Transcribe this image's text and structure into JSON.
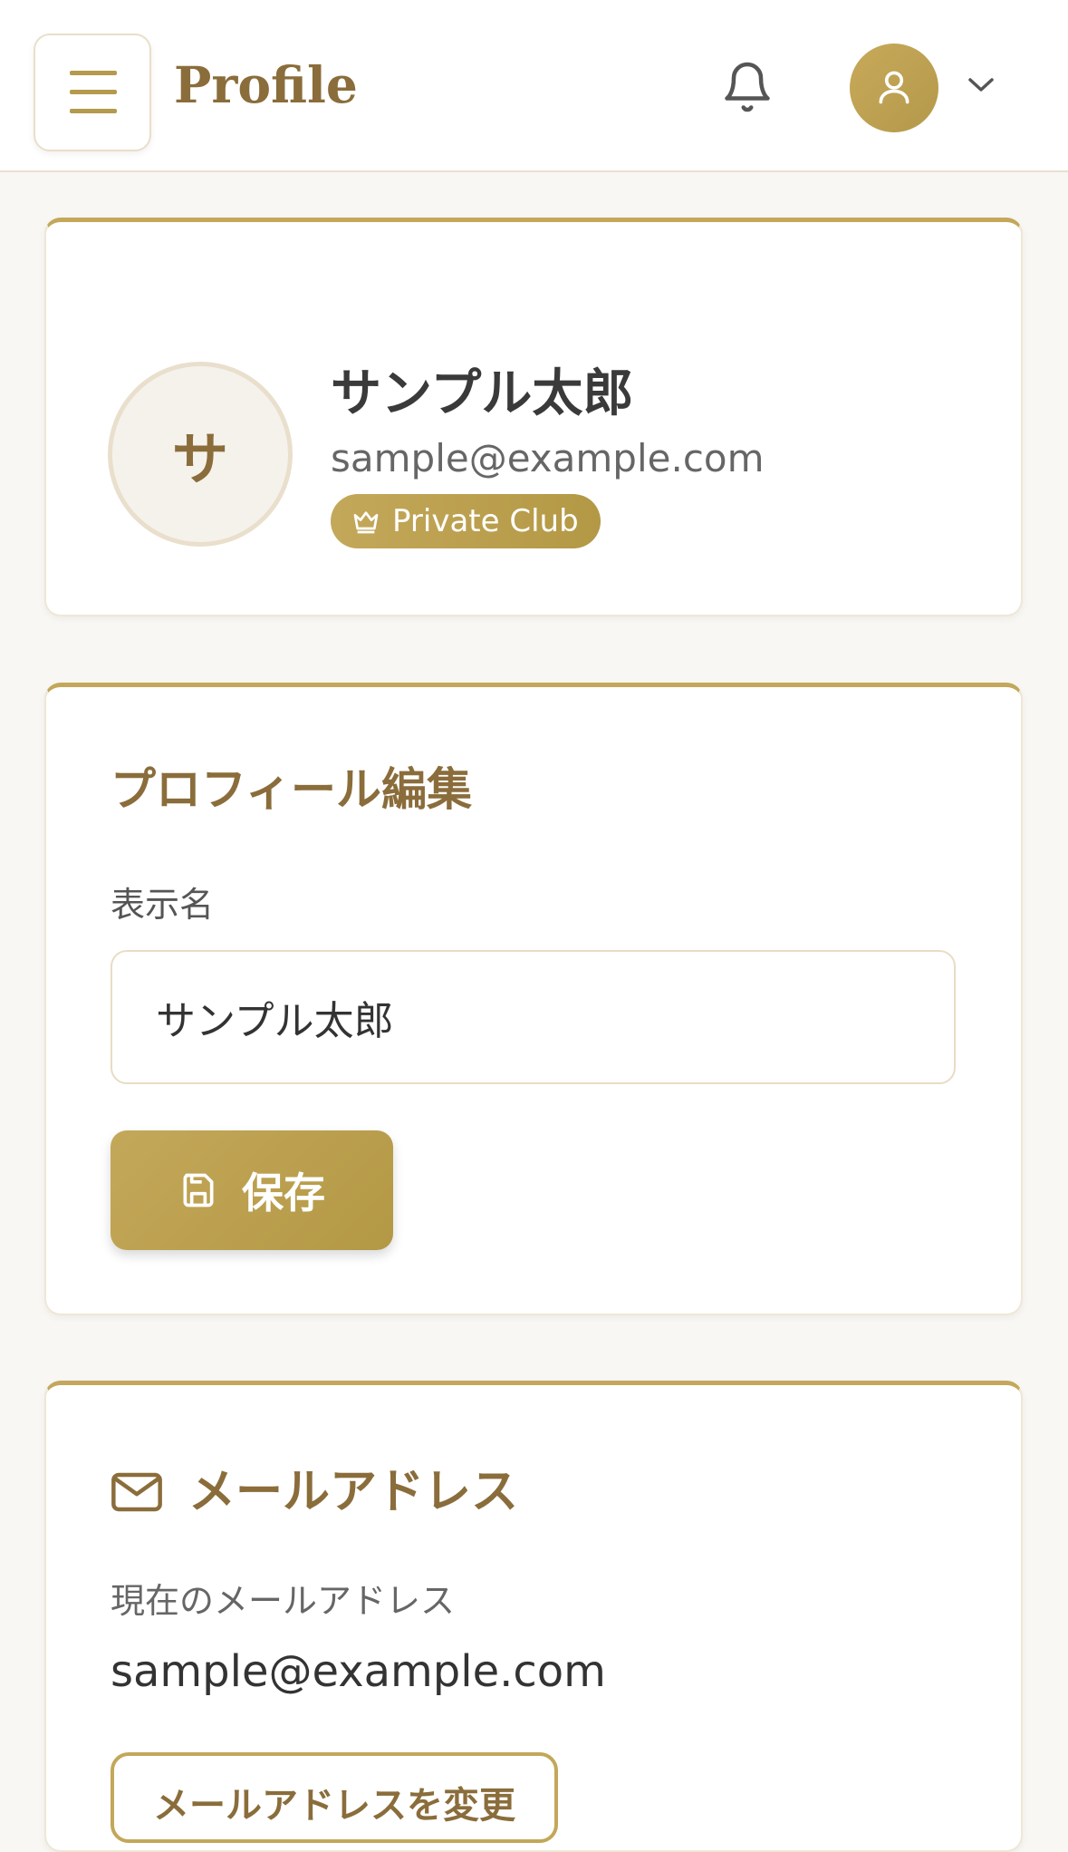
{
  "header": {
    "title": "Profile",
    "menu_icon": "hamburger-menu-icon",
    "notification_icon": "bell-icon",
    "account_icon": "user-icon",
    "dropdown_icon": "chevron-down-icon"
  },
  "profile_card": {
    "avatar_initial": "サ",
    "name": "サンプル太郎",
    "email": "sample@example.com",
    "badge": {
      "icon": "crown-icon",
      "label": "Private Club"
    }
  },
  "edit_card": {
    "title": "プロフィール編集",
    "display_name_label": "表示名",
    "display_name_value": "サンプル太郎",
    "save_icon": "save-icon",
    "save_label": "保存"
  },
  "email_card": {
    "icon": "mail-icon",
    "title": "メールアドレス",
    "current_label": "現在のメールアドレス",
    "current_email": "sample@example.com",
    "change_label": "メールアドレスを変更"
  },
  "colors": {
    "accent": "#c3a75a",
    "brand_text": "#8a6d3b",
    "background": "#f8f7f4"
  }
}
